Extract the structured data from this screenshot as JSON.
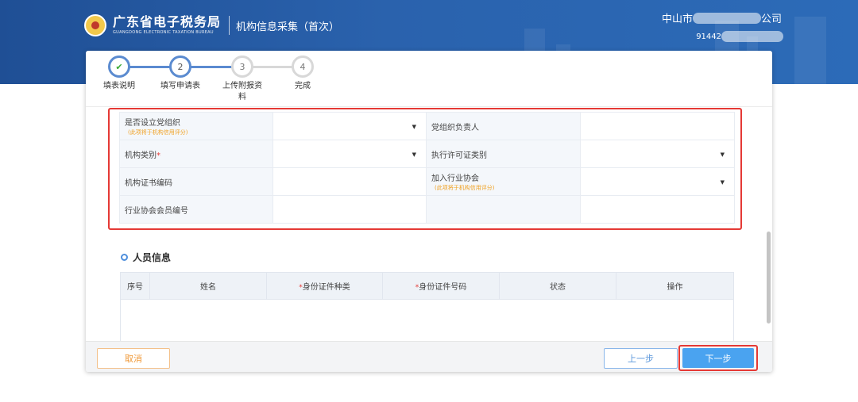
{
  "header": {
    "logo_cn": "广东省电子税务局",
    "logo_en": "GUANGDONG ELECTRONIC TAXATION BUREAU",
    "page_title": "机构信息采集（首次）",
    "company_prefix": "中山市",
    "company_suffix": "公司",
    "taxid_prefix": "91442"
  },
  "steps": [
    {
      "number": "✔",
      "label": "填表说明",
      "state": "done"
    },
    {
      "number": "2",
      "label": "填写申请表",
      "state": "current"
    },
    {
      "number": "3",
      "label": "上传附报资料",
      "state": "todo"
    },
    {
      "number": "4",
      "label": "完成",
      "state": "todo"
    }
  ],
  "form": {
    "party_org_label": "是否设立党组织",
    "party_org_hint": "(此项将于机构信用评分)",
    "party_leader_label": "党组织负责人",
    "org_type_label": "机构类别",
    "org_type_required": "*",
    "license_type_label": "执行许可证类别",
    "cert_no_label": "机构证书编码",
    "industry_assoc_label": "加入行业协会",
    "industry_assoc_hint": "(此项将于机构信用评分)",
    "member_no_label": "行业协会会员编号",
    "caret": "▼"
  },
  "personnel": {
    "title": "人员信息",
    "required_mark": "*",
    "columns": [
      "序号",
      "姓名",
      "身份证件种类",
      "身份证件号码",
      "状态",
      "操作"
    ]
  },
  "footer": {
    "cancel": "取消",
    "prev": "上一步",
    "next": "下一步"
  }
}
